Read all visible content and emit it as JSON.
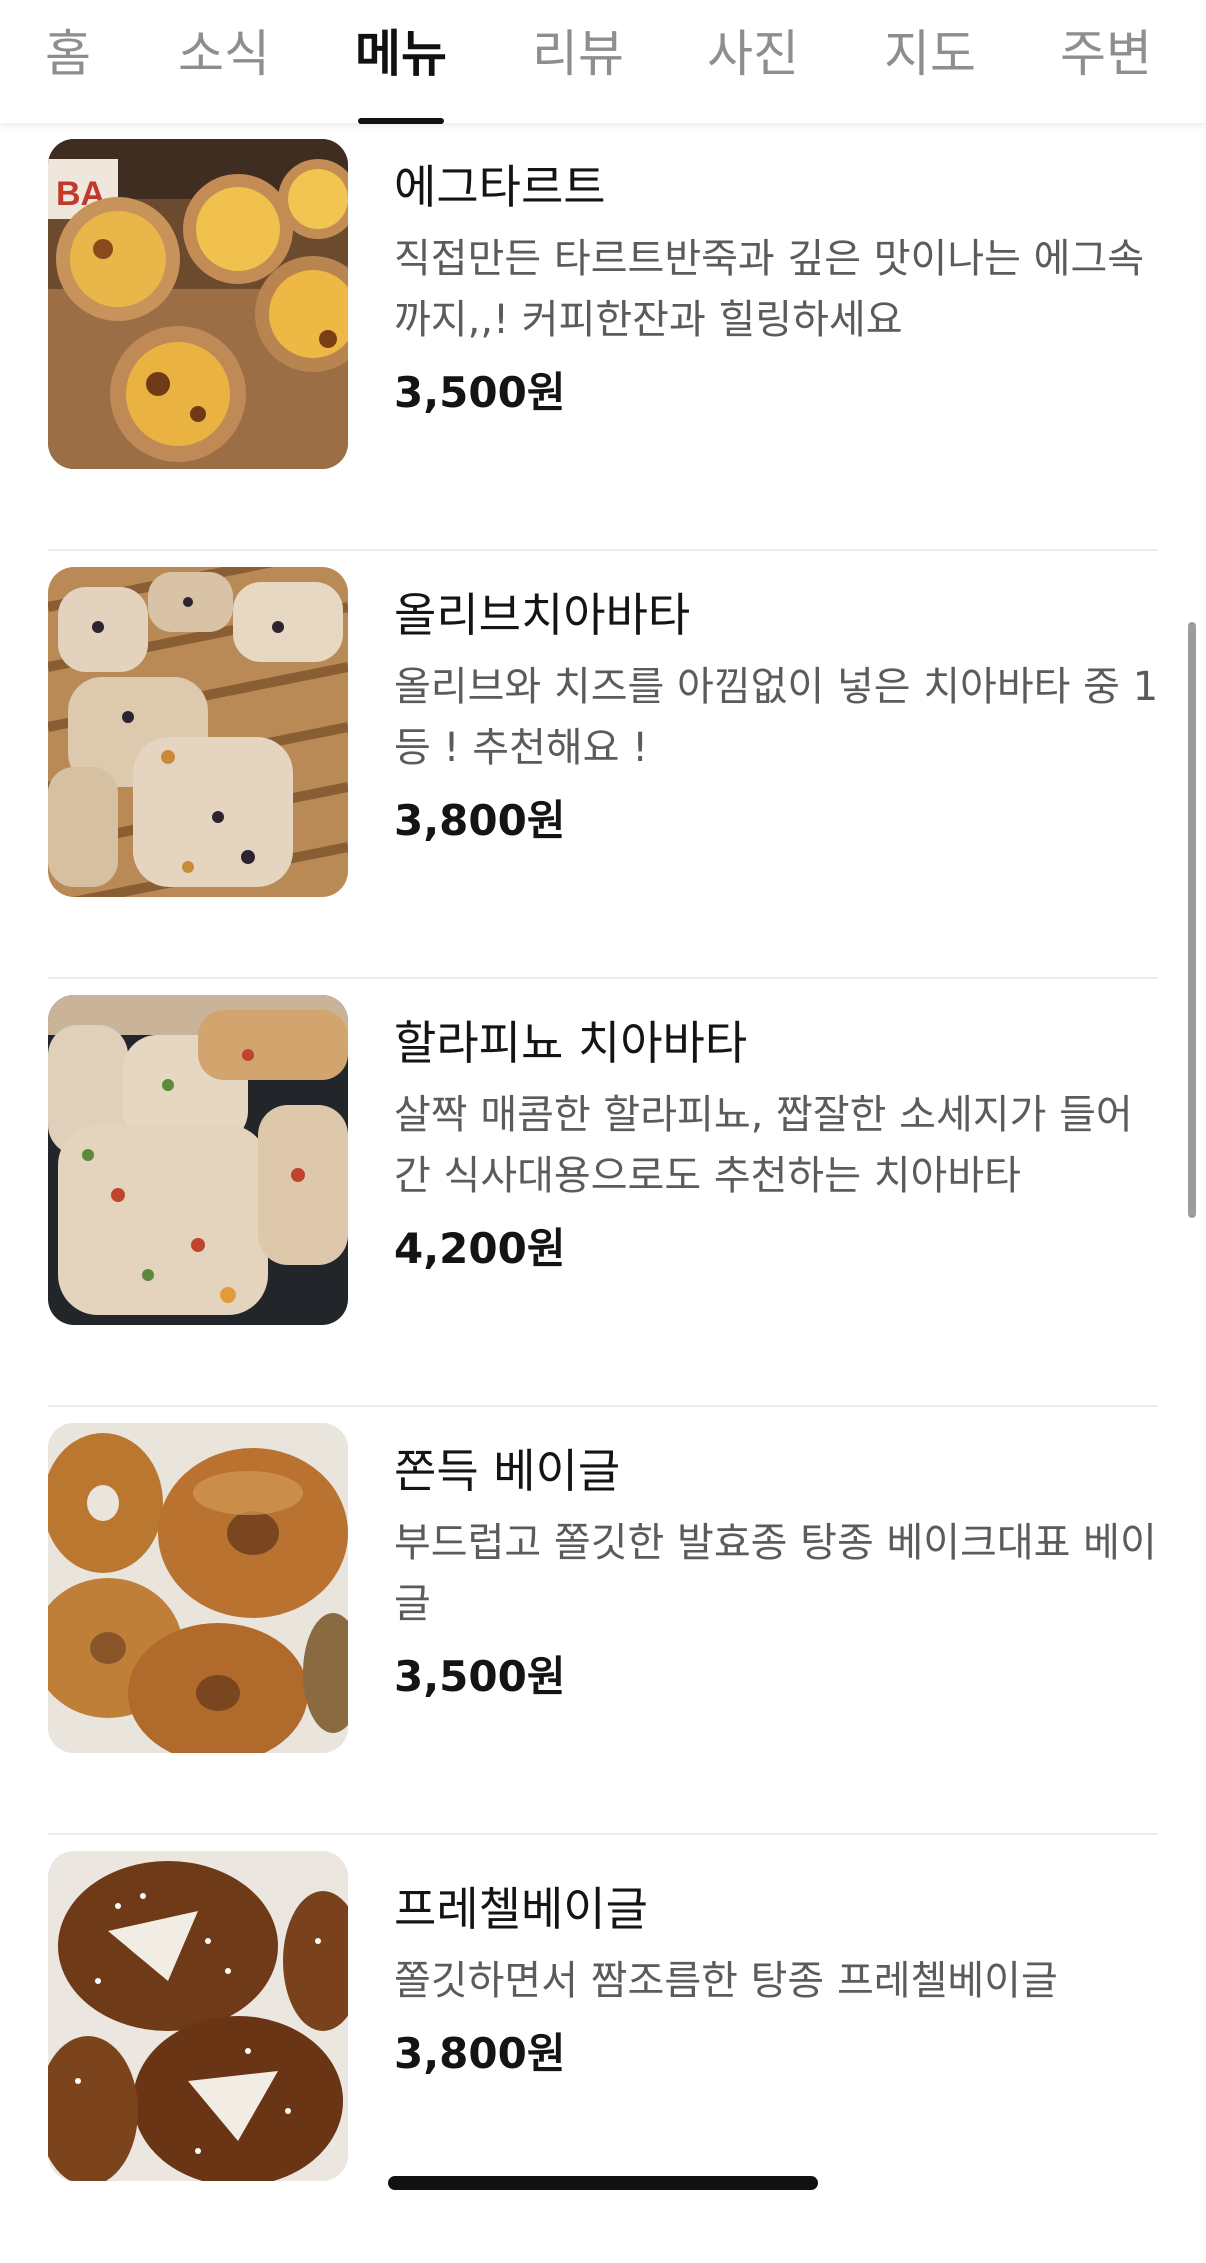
{
  "tabs": [
    {
      "label": "홈",
      "active": false
    },
    {
      "label": "소식",
      "active": false
    },
    {
      "label": "메뉴",
      "active": true
    },
    {
      "label": "리뷰",
      "active": false
    },
    {
      "label": "사진",
      "active": false
    },
    {
      "label": "지도",
      "active": false
    },
    {
      "label": "주변",
      "active": false
    }
  ],
  "menu_items": [
    {
      "name": "에그타르트",
      "description": "직접만든 타르트반죽과 깊은 맛이나는 에그속까지,,! 커피한잔과 힐링하세요",
      "price": "3,500원",
      "image": "egg-tart-photo"
    },
    {
      "name": "올리브치아바타",
      "description": "올리브와 치즈를 아낌없이 넣은 치아바타 중 1등 ! 추천해요 !",
      "price": "3,800원",
      "image": "olive-ciabatta-photo"
    },
    {
      "name": "할라피뇨 치아바타",
      "description": "살짝 매콤한 할라피뇨, 짭잘한 소세지가 들어간 식사대용으로도 추천하는 치아바타",
      "price": "4,200원",
      "image": "jalapeno-ciabatta-photo"
    },
    {
      "name": "쫀득 베이글",
      "description": "부드럽고 쫄깃한 발효종 탕종 베이크대표 베이글",
      "price": "3,500원",
      "image": "bagel-photo"
    },
    {
      "name": "프레첼베이글",
      "description": "쫄깃하면서 짬조름한 탕종 프레첼베이글",
      "price": "3,800원",
      "image": "pretzel-bagel-photo"
    }
  ],
  "colors": {
    "active_tab": "#111111",
    "inactive_tab": "#8e8e8e",
    "description": "#5b5b5b",
    "divider": "#eeeeee"
  }
}
